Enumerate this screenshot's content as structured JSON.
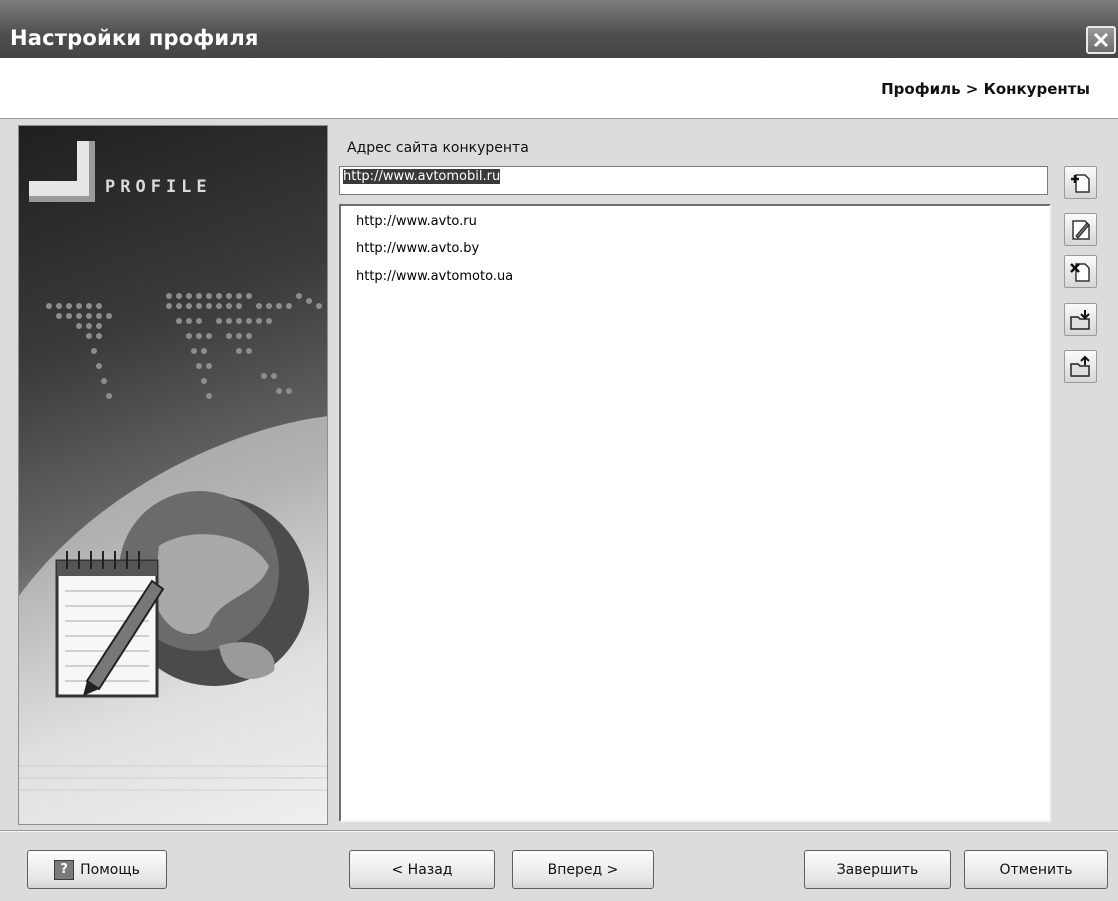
{
  "window": {
    "title": "Настройки профиля",
    "close_icon": "close-icon"
  },
  "header": {
    "breadcrumb": "Профиль > Конкуренты"
  },
  "sidebar_image": {
    "logo_text": "PROFILE"
  },
  "form": {
    "field_label": "Адрес сайта конкурента",
    "input_value": "http://www.avtomobil.ru",
    "list_items": [
      "http://www.avto.ru",
      "http://www.avto.by",
      "http://www.avtomoto.ua"
    ]
  },
  "toolbar": {
    "buttons": [
      {
        "icon": "add-icon"
      },
      {
        "icon": "edit-icon"
      },
      {
        "icon": "delete-icon"
      },
      {
        "icon": "import-icon"
      },
      {
        "icon": "export-icon"
      }
    ]
  },
  "footer": {
    "help_icon": "help-icon",
    "help_label": "Помощь",
    "back_label": "< Назад",
    "next_label": "Вперед >",
    "finish_label": "Завершить",
    "cancel_label": "Отменить"
  }
}
